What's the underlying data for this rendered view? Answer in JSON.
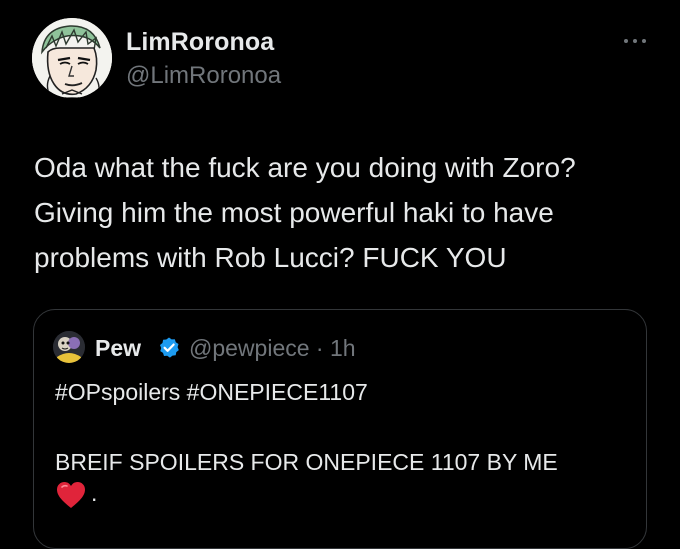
{
  "author": {
    "display_name": "LimRoronoa",
    "handle": "@LimRoronoa",
    "avatar_icon": "zoro-avatar-icon"
  },
  "menu": {
    "icon": "more-icon"
  },
  "tweet": {
    "lines": [
      "Oda what the fuck are you doing with Zoro?",
      "Giving him the most powerful haki to have",
      "problems with Rob Lucci? FUCK YOU"
    ]
  },
  "quote": {
    "author_name": "Pew",
    "verified_icon": "verified-badge-icon",
    "handle_time": "@pewpiece · 1h",
    "hashtags": "#OPspoilers  #ONEPIECE1107",
    "spoiler_text": "BREIF SPOILERS FOR ONEPIECE 1107 BY ME",
    "trailing_text": ".",
    "heart_icon": "red-heart-icon"
  },
  "colors": {
    "background": "#000000",
    "primary_text": "#e7e9ea",
    "secondary_text": "#71767b",
    "border": "#333639",
    "verified": "#1d9bf0",
    "heart": "#e0243a"
  }
}
